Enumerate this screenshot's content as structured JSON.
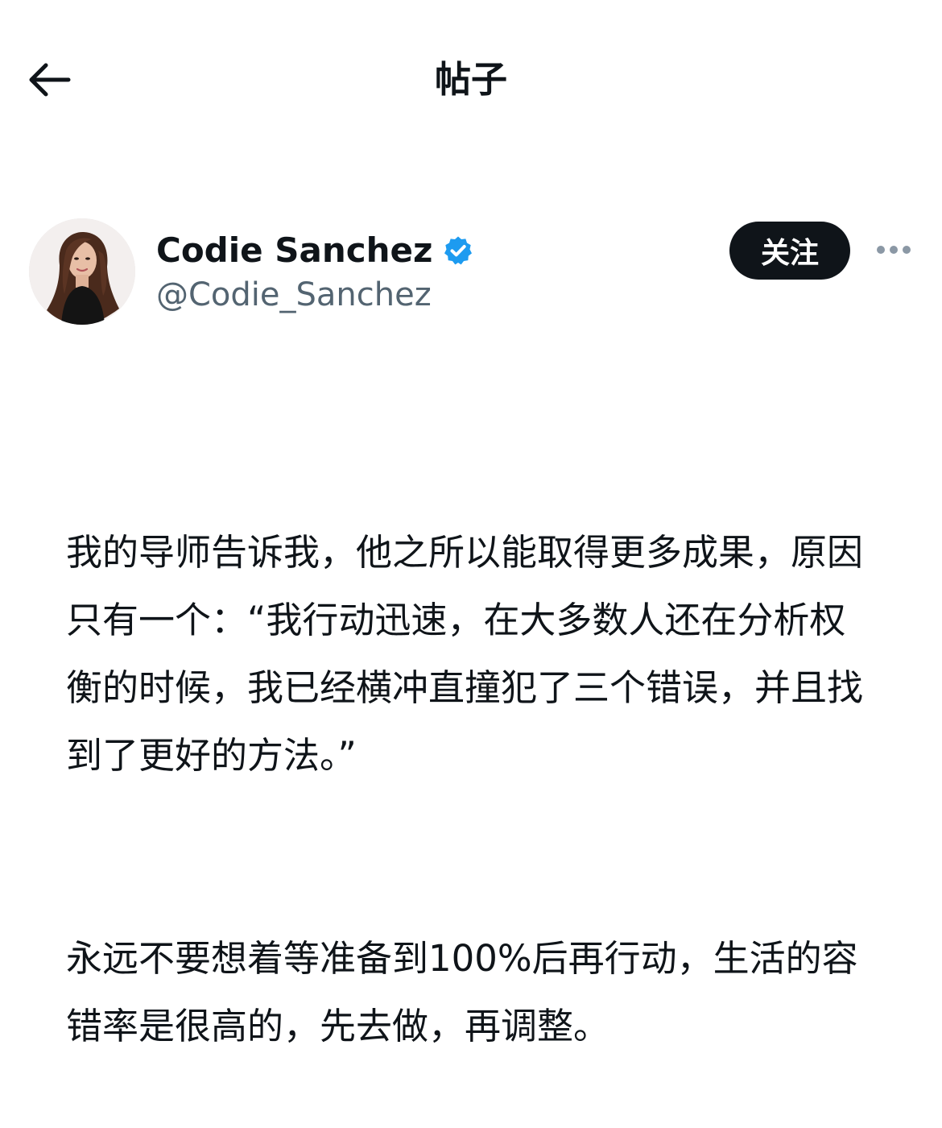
{
  "header": {
    "title": "帖子",
    "back_icon": "arrow-left-icon"
  },
  "author": {
    "display_name": "Codie Sanchez",
    "handle": "@Codie_Sanchez",
    "verified": true,
    "verified_color": "#1d9bf0",
    "follow_label": "关注",
    "more_icon": "more-horizontal-icon"
  },
  "post": {
    "paragraphs": [
      "我的导师告诉我，他之所以能取得更多成果，原因只有一个：“我行动迅速，在大多数人还在分析权衡的时候，我已经横冲直撞犯了三个错误，并且找到了更好的方法。”",
      "永远不要想着等准备到100%后再行动，生活的容错率是很高的，先去做，再调整。"
    ]
  },
  "colors": {
    "text_primary": "#0f1419",
    "text_secondary": "#536471",
    "button_bg": "#0f1419",
    "button_text": "#ffffff",
    "verified": "#1d9bf0"
  }
}
